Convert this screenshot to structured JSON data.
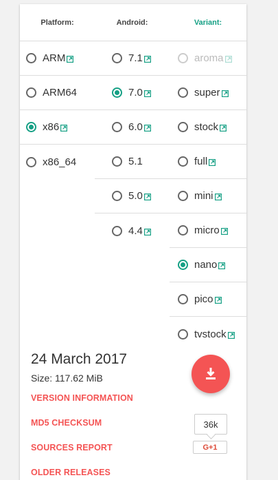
{
  "headers": {
    "platform": "Platform:",
    "android": "Android:",
    "variant": "Variant:"
  },
  "platform": [
    {
      "label": "ARM",
      "checked": false,
      "ext": true
    },
    {
      "label": "ARM64",
      "checked": false,
      "ext": false
    },
    {
      "label": "x86",
      "checked": true,
      "ext": true
    },
    {
      "label": "x86_64",
      "checked": false,
      "ext": false
    }
  ],
  "android": [
    {
      "label": "7.1",
      "checked": false,
      "ext": true
    },
    {
      "label": "7.0",
      "checked": true,
      "ext": true
    },
    {
      "label": "6.0",
      "checked": false,
      "ext": true
    },
    {
      "label": "5.1",
      "checked": false,
      "ext": false
    },
    {
      "label": "5.0",
      "checked": false,
      "ext": true
    },
    {
      "label": "4.4",
      "checked": false,
      "ext": true
    }
  ],
  "variant": [
    {
      "label": "aroma",
      "checked": false,
      "ext": true,
      "disabled": true
    },
    {
      "label": "super",
      "checked": false,
      "ext": true
    },
    {
      "label": "stock",
      "checked": false,
      "ext": true
    },
    {
      "label": "full",
      "checked": false,
      "ext": true
    },
    {
      "label": "mini",
      "checked": false,
      "ext": true
    },
    {
      "label": "micro",
      "checked": false,
      "ext": true
    },
    {
      "label": "nano",
      "checked": true,
      "ext": true
    },
    {
      "label": "pico",
      "checked": false,
      "ext": true
    },
    {
      "label": "tvstock",
      "checked": false,
      "ext": true
    }
  ],
  "release": {
    "date": "24 March 2017",
    "size": "Size: 117.62 MiB",
    "links": [
      "VERSION INFORMATION",
      "MD5 CHECKSUM",
      "SOURCES REPORT",
      "OLDER RELEASES"
    ]
  },
  "social": {
    "count": "36k",
    "gplus": "G+1"
  },
  "colors": {
    "accent": "#16a085",
    "red": "#f45454"
  },
  "icons": {
    "external": "external-link-icon",
    "download": "download-icon"
  }
}
